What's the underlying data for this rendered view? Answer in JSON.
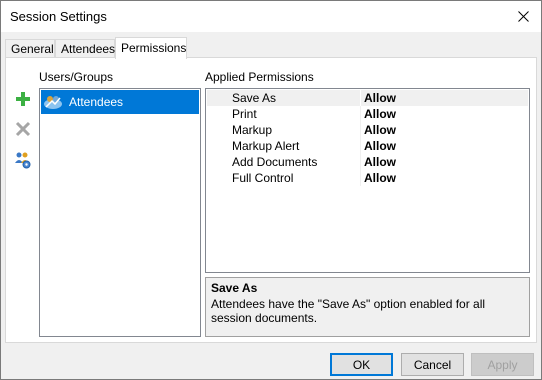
{
  "window": {
    "title": "Session Settings"
  },
  "tabs": [
    {
      "label": "General"
    },
    {
      "label": "Attendees"
    },
    {
      "label": "Permissions"
    }
  ],
  "users_groups": {
    "heading": "Users/Groups",
    "items": [
      {
        "label": "Attendees",
        "icon": "group-icon",
        "selected": true
      }
    ]
  },
  "toolbar": {
    "add_icon": "plus-icon",
    "remove_icon": "x-icon",
    "settings_icon": "users-settings-icon"
  },
  "permissions": {
    "heading": "Applied Permissions",
    "rows": [
      {
        "name": "Save As",
        "value": "Allow"
      },
      {
        "name": "Print",
        "value": "Allow"
      },
      {
        "name": "Markup",
        "value": "Allow"
      },
      {
        "name": "Markup Alert",
        "value": "Allow"
      },
      {
        "name": "Add Documents",
        "value": "Allow"
      },
      {
        "name": "Full Control",
        "value": "Allow"
      }
    ]
  },
  "description": {
    "title": "Save As",
    "text": "Attendees have the \"Save As\" option enabled for all session documents."
  },
  "buttons": {
    "ok": "OK",
    "cancel": "Cancel",
    "apply": "Apply"
  },
  "colors": {
    "selection": "#0078d7",
    "window_bg": "#f0f0f0"
  }
}
